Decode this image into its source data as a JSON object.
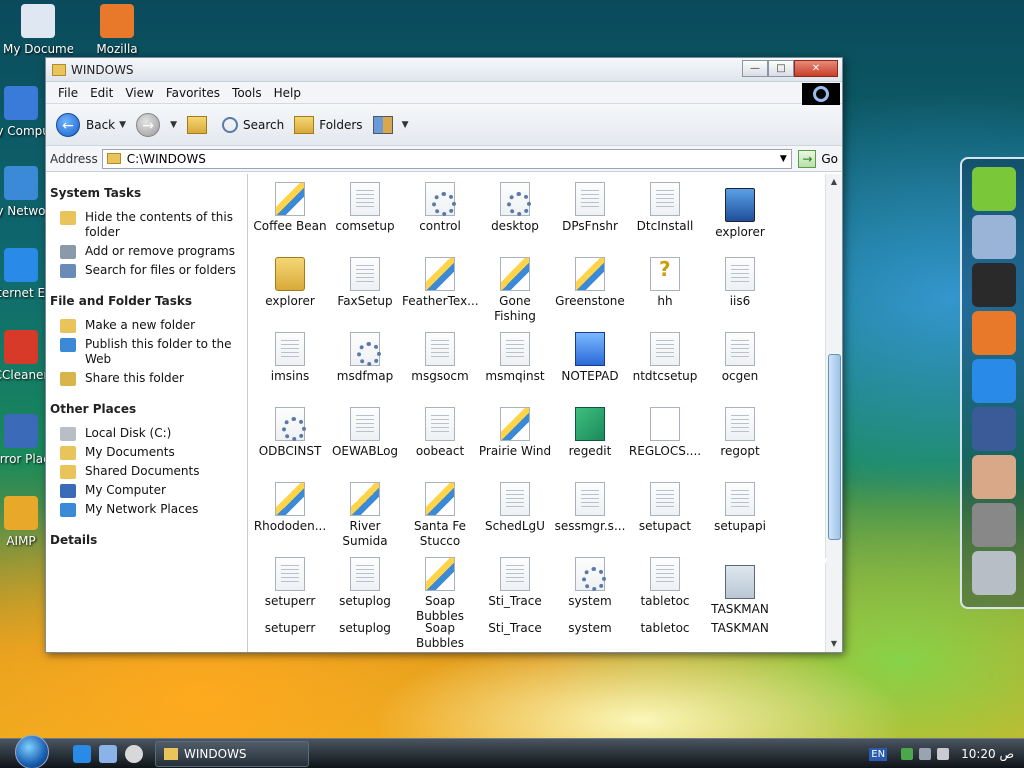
{
  "desktop_icons": [
    {
      "label": "My Documents",
      "color": "#dfe7f2"
    },
    {
      "label": "Mozilla",
      "color": "#e8782a"
    },
    {
      "label": "My Computer",
      "color": "#3a7ad8"
    },
    {
      "label": "My Network Places",
      "color": "#3a8ad8"
    },
    {
      "label": "Internet Explorer",
      "color": "#2a8ae8"
    },
    {
      "label": "CCleaner",
      "color": "#d83a2a"
    },
    {
      "label": "Mirror Places",
      "color": "#3a6ab8"
    },
    {
      "label": "AIMP",
      "color": "#e8a82a"
    }
  ],
  "window": {
    "title": "WINDOWS",
    "buttons": {
      "minimize": "—",
      "maximize": "□",
      "close": "✕"
    }
  },
  "menu": [
    "File",
    "Edit",
    "View",
    "Favorites",
    "Tools",
    "Help"
  ],
  "toolbar": {
    "back_label": "Back",
    "search_label": "Search",
    "folders_label": "Folders"
  },
  "address": {
    "label": "Address",
    "value": "C:\\WINDOWS",
    "go_label": "Go"
  },
  "left_pane": {
    "system_tasks": {
      "title": "System Tasks",
      "items": [
        {
          "label": "Hide the contents of this folder",
          "icon": "folder-icon",
          "color": "#e8c45a"
        },
        {
          "label": "Add or remove programs",
          "icon": "programs-icon",
          "color": "#8a9aa8"
        },
        {
          "label": "Search for files or folders",
          "icon": "search-icon",
          "color": "#6a8ab8"
        }
      ]
    },
    "file_folder_tasks": {
      "title": "File and Folder Tasks",
      "items": [
        {
          "label": "Make a new folder",
          "icon": "new-folder-icon",
          "color": "#e8c45a"
        },
        {
          "label": "Publish this folder to the Web",
          "icon": "publish-web-icon",
          "color": "#3a8ad8"
        },
        {
          "label": "Share this folder",
          "icon": "share-folder-icon",
          "color": "#d8b44a"
        }
      ]
    },
    "other_places": {
      "title": "Other Places",
      "items": [
        {
          "label": "Local Disk (C:)",
          "icon": "disk-icon",
          "color": "#b8bec6"
        },
        {
          "label": "My Documents",
          "icon": "documents-icon",
          "color": "#e8c45a"
        },
        {
          "label": "Shared Documents",
          "icon": "shared-documents-icon",
          "color": "#e8c45a"
        },
        {
          "label": "My Computer",
          "icon": "computer-icon",
          "color": "#3a6ab8"
        },
        {
          "label": "My Network Places",
          "icon": "network-icon",
          "color": "#3a8ad8"
        }
      ]
    },
    "details": {
      "title": "Details"
    }
  },
  "files": [
    {
      "name": "Coffee Bean",
      "icon": "paint"
    },
    {
      "name": "comsetup",
      "icon": "doc"
    },
    {
      "name": "control",
      "icon": "gear"
    },
    {
      "name": "desktop",
      "icon": "gear"
    },
    {
      "name": "DPsFnshr",
      "icon": "doc"
    },
    {
      "name": "DtcInstall",
      "icon": "doc"
    },
    {
      "name": "explorer",
      "icon": "pc"
    },
    {
      "name": "explorer",
      "icon": "folderbig"
    },
    {
      "name": "FaxSetup",
      "icon": "doc"
    },
    {
      "name": "FeatherTex...",
      "icon": "paint"
    },
    {
      "name": "Gone Fishing",
      "icon": "paint"
    },
    {
      "name": "Greenstone",
      "icon": "paint"
    },
    {
      "name": "hh",
      "icon": "help"
    },
    {
      "name": "iis6",
      "icon": "doc"
    },
    {
      "name": "imsins",
      "icon": "doc"
    },
    {
      "name": "msdfmap",
      "icon": "gear"
    },
    {
      "name": "msgsocm",
      "icon": "doc"
    },
    {
      "name": "msmqinst",
      "icon": "doc"
    },
    {
      "name": "NOTEPAD",
      "icon": "note"
    },
    {
      "name": "ntdtcsetup",
      "icon": "doc"
    },
    {
      "name": "ocgen",
      "icon": "doc"
    },
    {
      "name": "ODBCINST",
      "icon": "gear"
    },
    {
      "name": "OEWABLog",
      "icon": "doc"
    },
    {
      "name": "oobeact",
      "icon": "doc"
    },
    {
      "name": "Prairie Wind",
      "icon": "paint"
    },
    {
      "name": "regedit",
      "icon": "cubes"
    },
    {
      "name": "REGLOCS....",
      "icon": "blank"
    },
    {
      "name": "regopt",
      "icon": "doc"
    },
    {
      "name": "Rhododen...",
      "icon": "paint"
    },
    {
      "name": "River Sumida",
      "icon": "paint"
    },
    {
      "name": "Santa Fe Stucco",
      "icon": "paint"
    },
    {
      "name": "SchedLgU",
      "icon": "doc"
    },
    {
      "name": "sessmgr.s...",
      "icon": "doc"
    },
    {
      "name": "setupact",
      "icon": "doc"
    },
    {
      "name": "setupapi",
      "icon": "doc"
    },
    {
      "name": "setuperr",
      "icon": "doc"
    },
    {
      "name": "setuplog",
      "icon": "doc"
    },
    {
      "name": "Soap Bubbles",
      "icon": "paint"
    },
    {
      "name": "Sti_Trace",
      "icon": "doc"
    },
    {
      "name": "system",
      "icon": "gear"
    },
    {
      "name": "tabletoc",
      "icon": "doc"
    },
    {
      "name": "TASKMAN",
      "icon": "taskman"
    }
  ],
  "files_overflow": [
    "setuperr",
    "setuplog",
    "Soap Bubbles",
    "Sti_Trace",
    "system",
    "tabletoc",
    "TASKMAN"
  ],
  "dock_items": [
    {
      "name": "android-icon",
      "color": "#7ac83a"
    },
    {
      "name": "satellite-icon",
      "color": "#9ab4d8"
    },
    {
      "name": "tablet-icon",
      "color": "#2a2a2a"
    },
    {
      "name": "firefox-icon",
      "color": "#e8782a"
    },
    {
      "name": "ie-icon",
      "color": "#2a8ae8"
    },
    {
      "name": "facebook-icon",
      "color": "#3a5a98"
    },
    {
      "name": "support-person-icon",
      "color": "#d8a888"
    },
    {
      "name": "settings-gear-icon",
      "color": "#888"
    },
    {
      "name": "trash-icon",
      "color": "#b8bec6"
    }
  ],
  "taskbar": {
    "task_label": "WINDOWS",
    "lang": "EN",
    "clock": "10:20 ص"
  }
}
